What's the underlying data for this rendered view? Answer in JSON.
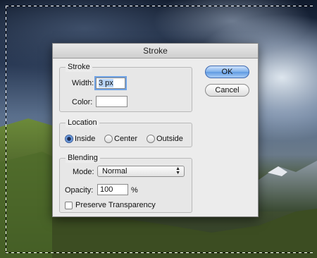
{
  "dialog": {
    "title": "Stroke",
    "stroke": {
      "group_label": "Stroke",
      "width_label": "Width:",
      "width_value": "3 px",
      "color_label": "Color:",
      "color_swatch": "#ffffff"
    },
    "location": {
      "group_label": "Location",
      "options": [
        "Inside",
        "Center",
        "Outside"
      ],
      "selected": "Inside"
    },
    "blending": {
      "group_label": "Blending",
      "mode_label": "Mode:",
      "mode_value": "Normal",
      "opacity_label": "Opacity:",
      "opacity_value": "100",
      "opacity_unit": "%",
      "preserve_label": "Preserve Transparency",
      "preserve_checked": false
    },
    "buttons": {
      "ok_label": "OK",
      "cancel_label": "Cancel"
    }
  },
  "colors": {
    "default_button": "#5f9ae2",
    "focus_ring": "#6fa3e6",
    "dialog_bg": "#ececec"
  }
}
